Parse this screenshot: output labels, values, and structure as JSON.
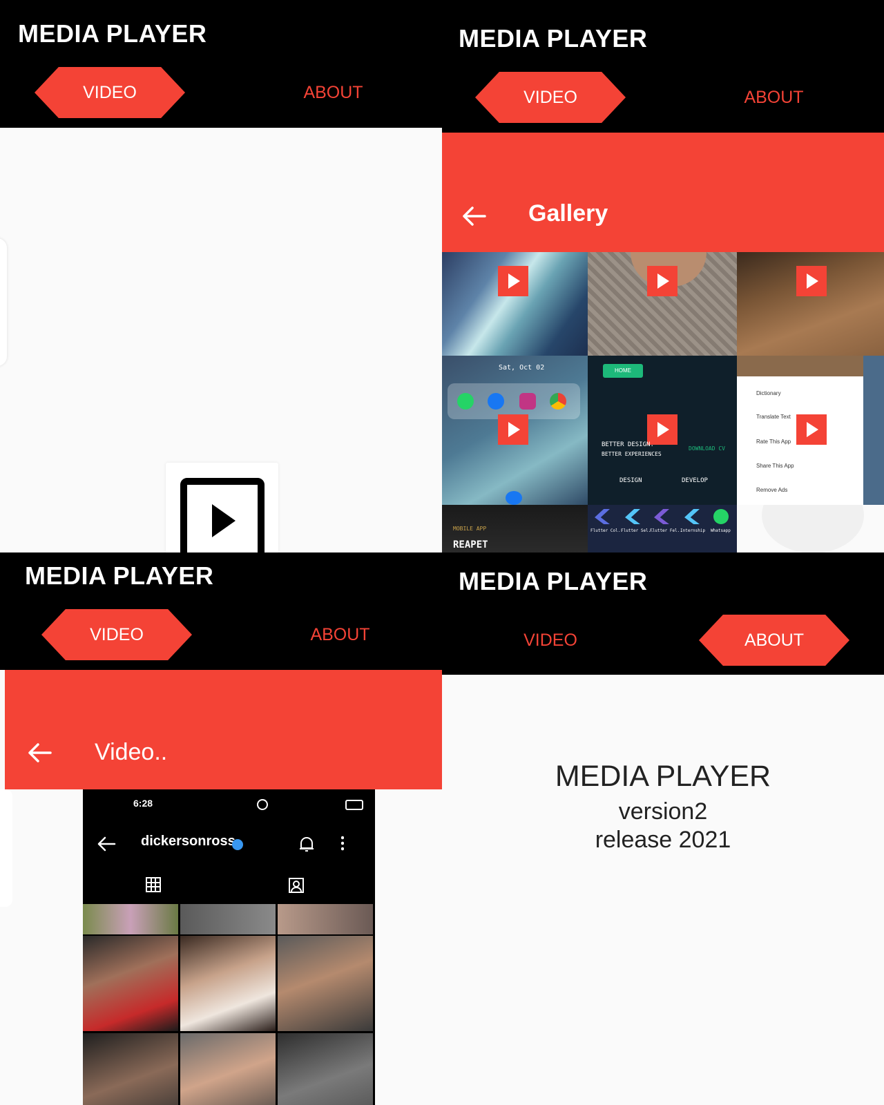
{
  "app": {
    "title": "MEDIA PLAYER",
    "tabs": {
      "video": "VIDEO",
      "about": "ABOUT"
    },
    "accent_color": "#f44336"
  },
  "panel2": {
    "page_title": "Gallery",
    "back_icon": "arrow-left-icon",
    "thumbs": {
      "t4_date": "Sat, Oct 02",
      "t5_button": "HOME",
      "t5_heading": "BETTER DESIGN.",
      "t5_sub": "BETTER EXPERIENCES",
      "t5_download": "DOWNLOAD CV",
      "t5_design": "DESIGN",
      "t5_develop": "DEVELOP",
      "t6_menu": [
        "Dictionary",
        "Translate Text",
        "Rate This App",
        "Share This App",
        "Remove Ads"
      ],
      "t7_tag": "MOBILE APP",
      "t7_title": "REAPET",
      "t8_labels": [
        "Flutter Col..",
        "Flutter Sel..",
        "Flutter Fel..",
        "Internship",
        "Whatsapp"
      ]
    }
  },
  "panel3": {
    "page_title": "Video..",
    "back_icon": "arrow-left-icon",
    "screenshot": {
      "time": "6:28",
      "handle": "dickersonross",
      "verified_icon": "verified-badge-icon",
      "bell_icon": "bell-icon",
      "more_icon": "more-vertical-icon",
      "grid_icon": "grid-icon",
      "tagged_icon": "tagged-person-icon"
    }
  },
  "panel4": {
    "about_title": "MEDIA PLAYER",
    "about_version": "version2",
    "about_release": "release 2021"
  }
}
